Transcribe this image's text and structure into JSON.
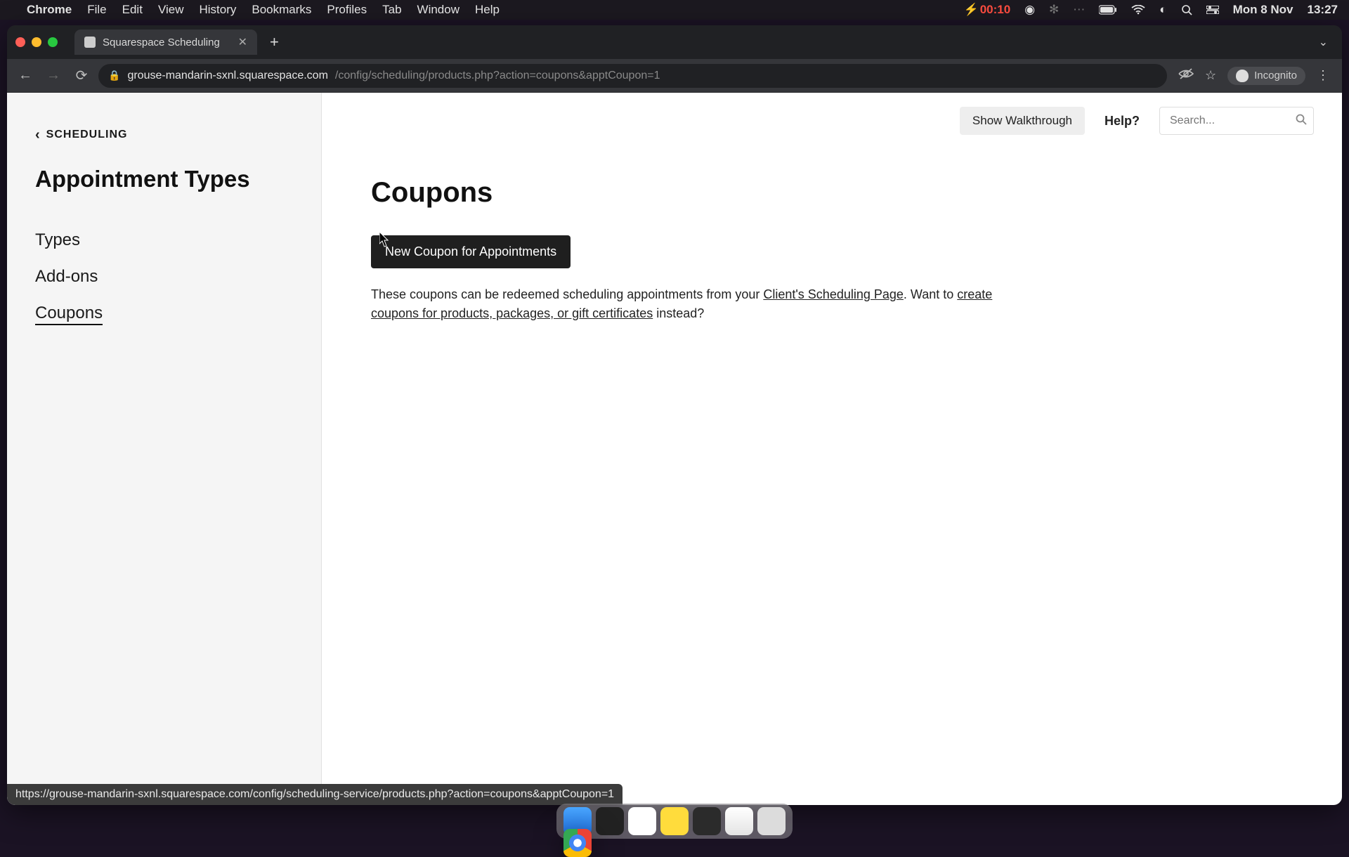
{
  "menubar": {
    "app": "Chrome",
    "items": [
      "File",
      "Edit",
      "View",
      "History",
      "Bookmarks",
      "Profiles",
      "Tab",
      "Window",
      "Help"
    ],
    "battery": "00:10",
    "date": "Mon 8 Nov",
    "time": "13:27"
  },
  "chrome": {
    "tab_title": "Squarespace Scheduling",
    "url_host": "grouse-mandarin-sxnl.squarespace.com",
    "url_path": "/config/scheduling/products.php?action=coupons&apptCoupon=1",
    "incognito_label": "Incognito"
  },
  "sidebar": {
    "back_label": "SCHEDULING",
    "heading": "Appointment Types",
    "items": [
      {
        "label": "Types",
        "active": false
      },
      {
        "label": "Add-ons",
        "active": false
      },
      {
        "label": "Coupons",
        "active": true
      }
    ]
  },
  "topbar": {
    "walkthrough": "Show Walkthrough",
    "help": "Help?",
    "search_placeholder": "Search..."
  },
  "main": {
    "title": "Coupons",
    "new_button": "New Coupon for Appointments",
    "copy_prefix": "These coupons can be redeemed scheduling appointments from your ",
    "copy_link1": "Client's Scheduling Page",
    "copy_after1": ". Want to ",
    "copy_link2": "create coupons for products, packages, or gift certificates",
    "copy_after2": " instead?"
  },
  "statusbar": "https://grouse-mandarin-sxnl.squarespace.com/config/scheduling-service/products.php?action=coupons&apptCoupon=1"
}
